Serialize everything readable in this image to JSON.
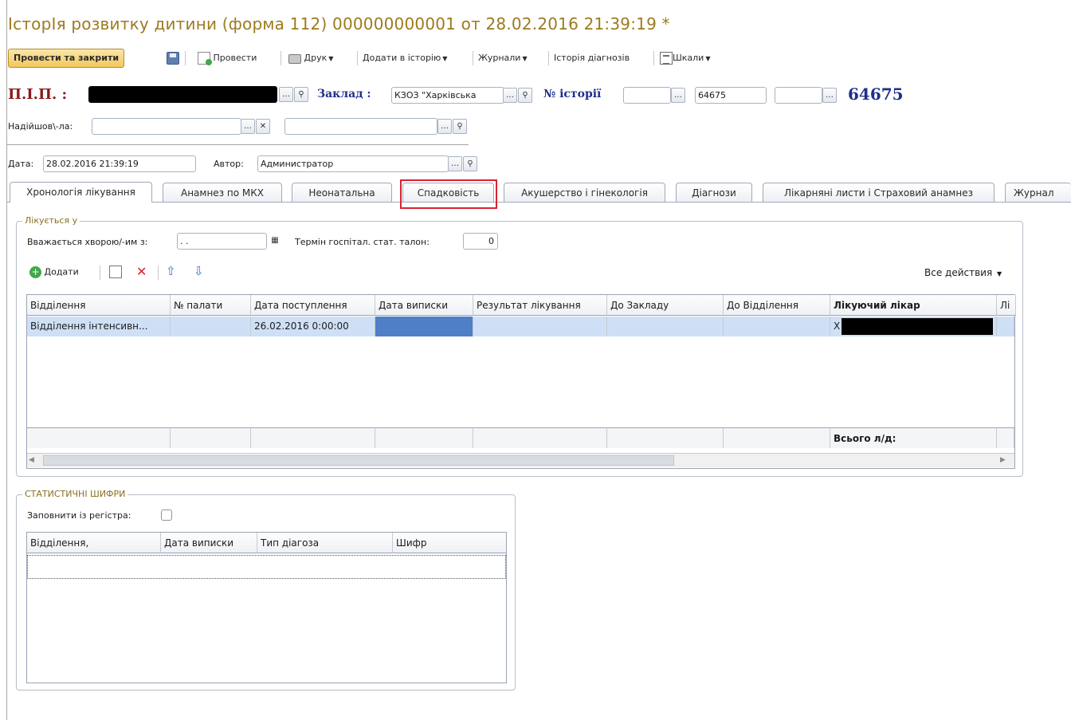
{
  "window": {
    "title": "ІсторІя розвитку дитини (форма 112) 000000000001 от 28.02.2016 21:39:19 *"
  },
  "toolbar": {
    "post_close": "Провести та закрити",
    "post": "Провести",
    "print": "Друк",
    "add_history": "Додати в історію",
    "journals": "Журнали",
    "diag_history": "Історія діагнозів",
    "scales": "Шкали"
  },
  "header": {
    "pib_label": "П.І.П. :",
    "zaklad_label": "Заклад :",
    "zaklad_value": "КЗОЗ \"Харківська",
    "history_label": "№ історії",
    "history_field2": "64675",
    "history_number": "64675",
    "arrived_label": "Надійшов\\-ла:",
    "date_label": "Дата:",
    "date_value": "28.02.2016 21:39:19",
    "author_label": "Автор:",
    "author_value": "Администратор"
  },
  "tabs": [
    "Хронологія лікування",
    "Анамнез по МКХ",
    "Неонатальна",
    "Спадковість",
    "Акушерство і гінекологія",
    "Діагнози",
    "Лікарняні листи і Страховий анамнез",
    "Журнал"
  ],
  "treatment": {
    "group_title": "Лікується у",
    "sick_since_label": "Вважається хворою/-им з:",
    "sick_since_value": "  .  .",
    "term_label": "Термін госпітал. стат. талон:",
    "term_value": "0",
    "add_label": "Додати",
    "all_actions": "Все действия",
    "columns": [
      "Відділення",
      "№ палати",
      "Дата поступлення",
      "Дата виписки",
      "Результат лікування",
      "До   Закладу",
      "До   Відділення",
      "Лікуючий лікар",
      "Лі"
    ],
    "rows": [
      [
        "Відділення інтенсивн...",
        "",
        "26.02.2016 0:00:00",
        "",
        "",
        "",
        "",
        "Х",
        ""
      ]
    ],
    "footer_total": "Всього л/д:"
  },
  "stats": {
    "group_title": "СТАТИСТИЧНІ ШИФРИ",
    "fill_label": "Заповнити із регістра:",
    "columns": [
      "Відділення,",
      "Дата виписки",
      "Тип діагоза",
      "Шифр"
    ]
  },
  "colors": {
    "title": "#9d7a1e",
    "label_maroon": "#8b1a1a",
    "label_blue": "#1f2f8c",
    "selected_row": "#cfe0f6",
    "selected_cell": "#4f7fc7",
    "highlight": "#d9232e"
  }
}
